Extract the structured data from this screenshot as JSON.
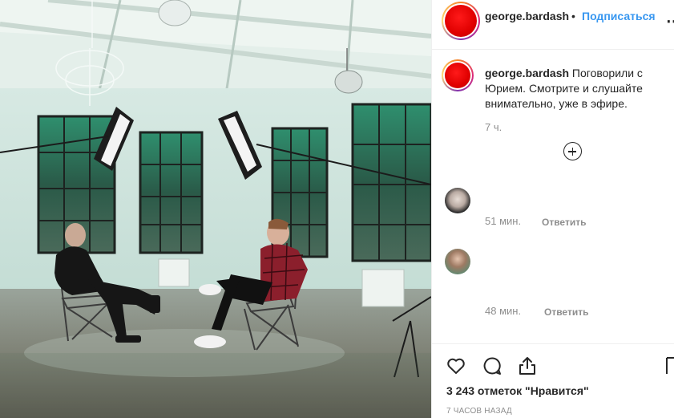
{
  "post": {
    "username": "george.bardash",
    "separator": "•",
    "follow_label": "Подписаться",
    "avatar_color": "#e60000"
  },
  "caption": {
    "username": "george.bardash",
    "text": "Поговорили с Юрием. Смотрите и слушайте внимательно, уже в эфире.",
    "time": "7 ч."
  },
  "comments": [
    {
      "time": "51 мин.",
      "reply_label": "Ответить"
    },
    {
      "time": "48 мин.",
      "reply_label": "Ответить"
    }
  ],
  "actions": {
    "likes": "3 243 отметок \"Нравится\"",
    "posted_ago": "7 ЧАСОВ НАЗАД",
    "icons": [
      "heart-icon",
      "comment-icon",
      "share-icon",
      "bookmark-icon"
    ]
  },
  "colors": {
    "accent": "#3897f0",
    "text": "#262626",
    "muted": "#8e8e8e"
  }
}
